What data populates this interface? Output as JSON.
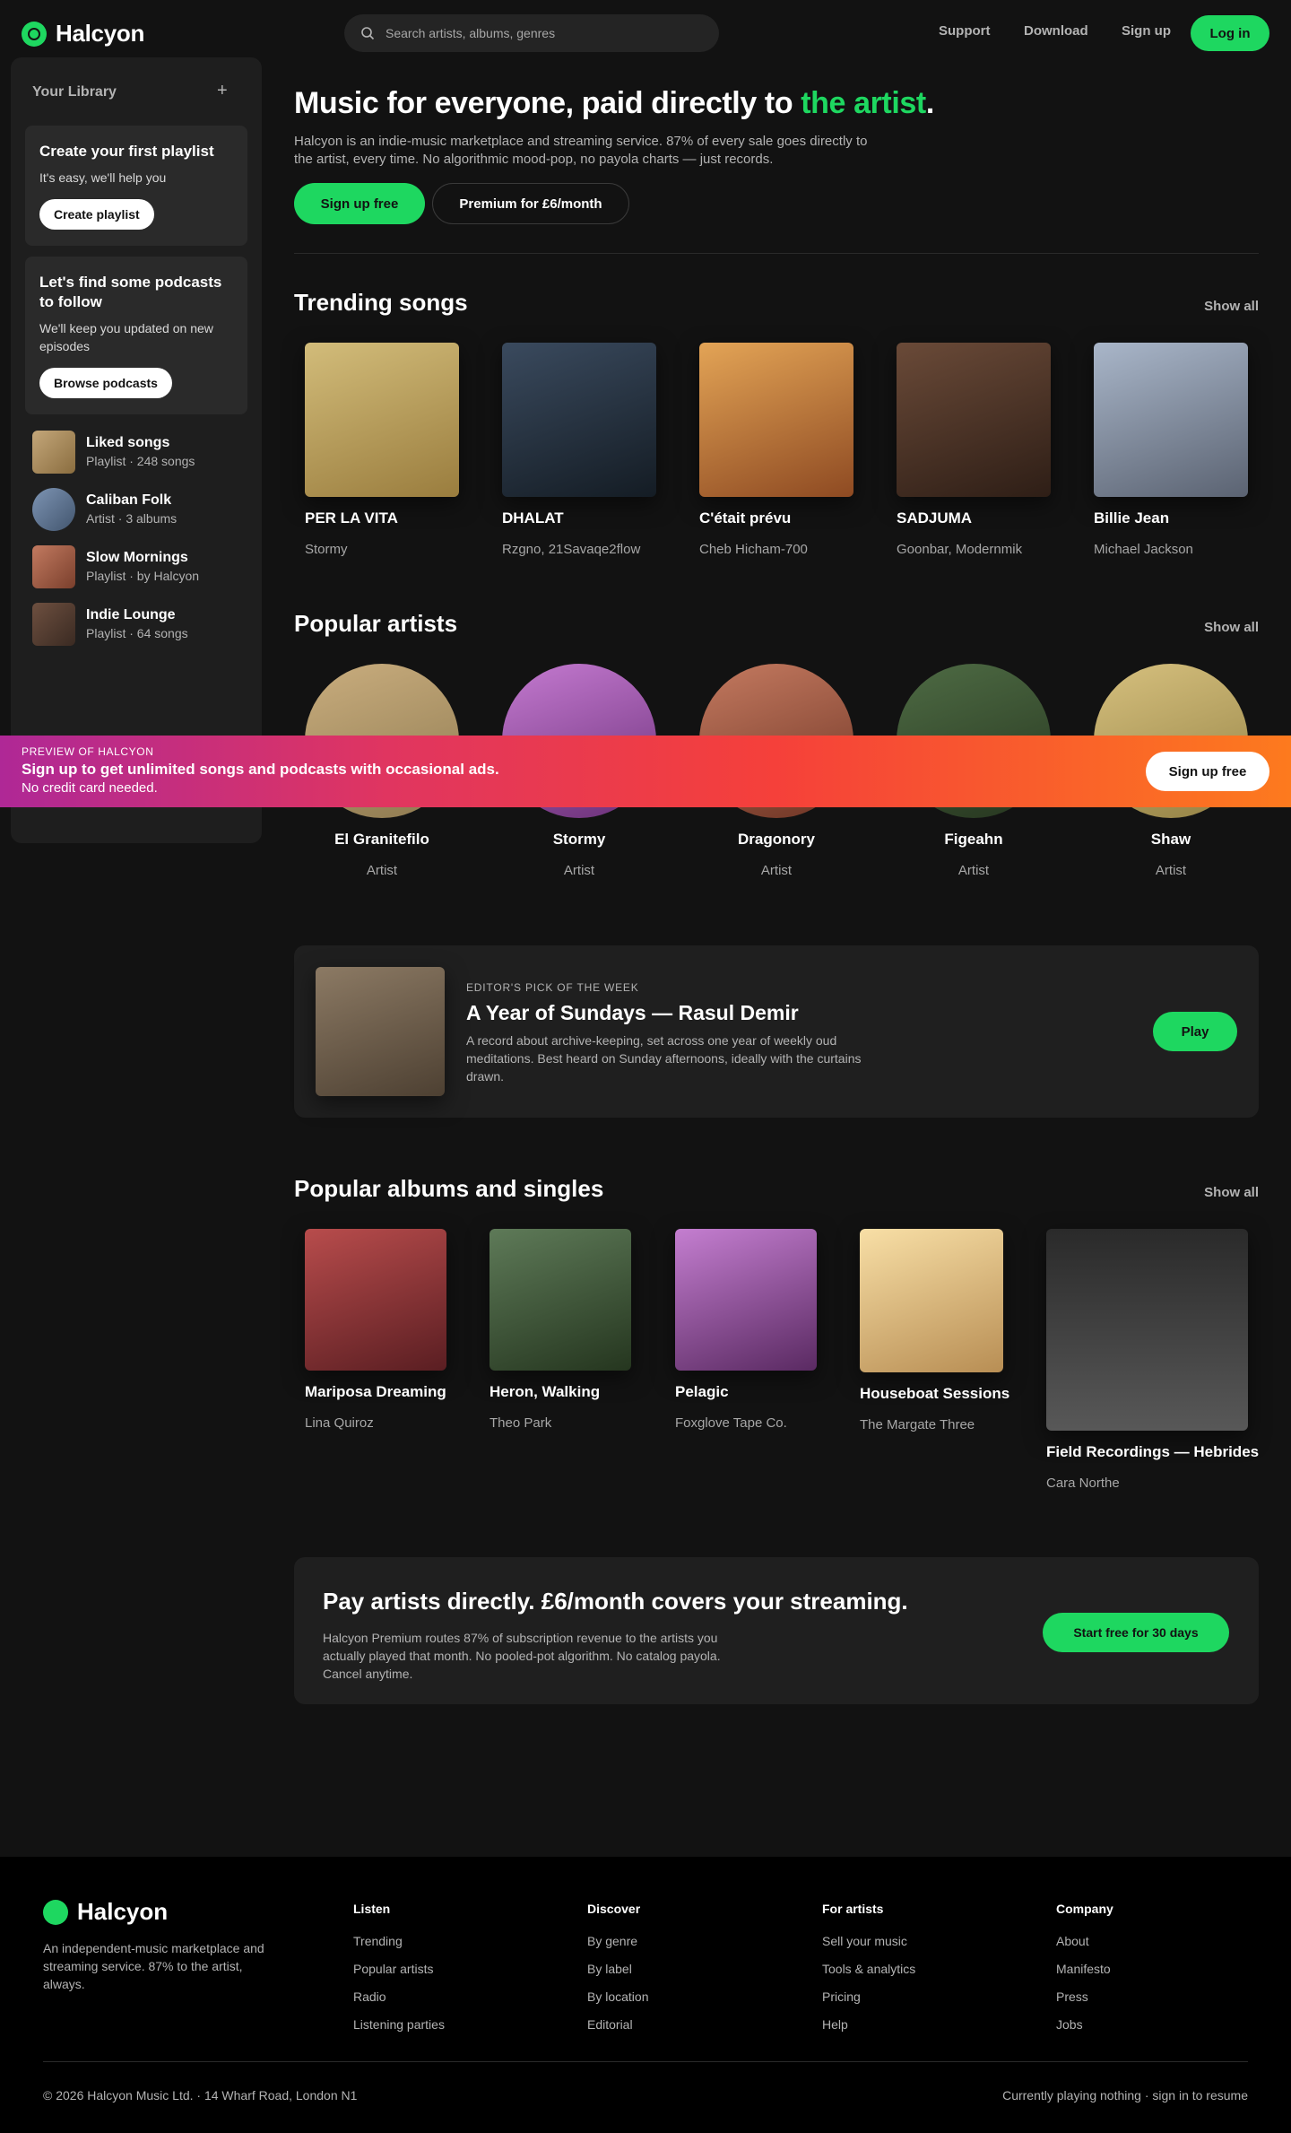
{
  "brand": {
    "name": "Halcyon",
    "accent": "#1ed760"
  },
  "search": {
    "placeholder": "Search artists, albums, genres",
    "icon": "search-icon"
  },
  "nav": {
    "support": "Support",
    "download": "Download",
    "signup": "Sign up",
    "login": "Log in"
  },
  "sidebar": {
    "title": "Your Library",
    "add_icon": "+",
    "playlist_card": {
      "title": "Create your first playlist",
      "text": "It's easy, we'll help you",
      "button": "Create playlist"
    },
    "podcast_card": {
      "title": "Let's find some podcasts to follow",
      "text": "We'll keep you updated on new episodes",
      "button": "Browse podcasts"
    },
    "items": [
      {
        "title": "Liked songs",
        "sub": "Playlist · 248 songs"
      },
      {
        "title": "Caliban Folk",
        "sub": "Artist · 3 albums"
      },
      {
        "title": "Slow Mornings",
        "sub": "Playlist · by Halcyon"
      },
      {
        "title": "Indie Lounge",
        "sub": "Playlist · 64 songs"
      }
    ]
  },
  "hero": {
    "title_prefix": "Music for everyone, paid directly to ",
    "title_accent": "the artist",
    "title_suffix": ".",
    "subtitle": "Halcyon is an indie-music marketplace and streaming service. 87% of every sale goes directly to the artist, every time. No algorithmic mood-pop, no payola charts — just records.",
    "primary_button": "Sign up free",
    "secondary_button": "Premium for £6/month"
  },
  "trending": {
    "title": "Trending songs",
    "show_all": "Show all",
    "items": [
      {
        "title": "PER LA VITA",
        "sub": "Stormy"
      },
      {
        "title": "DHALAT",
        "sub": "Rzgno, 21Savaqe2flow"
      },
      {
        "title": "C'était prévu",
        "sub": "Cheb Hicham-700"
      },
      {
        "title": "SADJUMA",
        "sub": "Goonbar, Modernmik"
      },
      {
        "title": "Billie Jean",
        "sub": "Michael Jackson"
      }
    ]
  },
  "artists": {
    "title": "Popular artists",
    "show_all": "Show all",
    "items": [
      {
        "name": "El Granitefilo",
        "role": "Artist"
      },
      {
        "name": "Stormy",
        "role": "Artist"
      },
      {
        "name": "Dragonory",
        "role": "Artist"
      },
      {
        "name": "Figeahn",
        "role": "Artist"
      },
      {
        "name": "Shaw",
        "role": "Artist"
      }
    ]
  },
  "banner": {
    "eyebrow": "PREVIEW OF HALCYON",
    "title": "Sign up to get unlimited songs and podcasts with occasional ads.",
    "sub": "No credit card needed.",
    "button": "Sign up free"
  },
  "editors_pick": {
    "eyebrow": "EDITOR'S PICK OF THE WEEK",
    "title": "A Year of Sundays — Rasul Demir",
    "text": "A record about archive-keeping, set across one year of weekly oud meditations. Best heard on Sunday afternoons, ideally with the curtains drawn.",
    "button": "Play"
  },
  "albums": {
    "title": "Popular albums and singles",
    "show_all": "Show all",
    "items": [
      {
        "title": "Mariposa Dreaming",
        "sub": "Lina Quiroz"
      },
      {
        "title": "Heron, Walking",
        "sub": "Theo Park"
      },
      {
        "title": "Pelagic",
        "sub": "Foxglove Tape Co."
      },
      {
        "title": "Houseboat Sessions",
        "sub": "The Margate Three"
      },
      {
        "title": "Field Recordings — Hebrides",
        "sub": "Cara Northe"
      }
    ]
  },
  "pay": {
    "title": "Pay artists directly. £6/month covers your streaming.",
    "text": "Halcyon Premium routes 87% of subscription revenue to the artists you actually played that month. No pooled-pot algorithm. No catalog payola. Cancel anytime.",
    "button": "Start free for 30 days"
  },
  "footer": {
    "brand": "Halcyon",
    "description": "An independent-music marketplace and streaming service. 87% to the artist, always.",
    "columns": [
      {
        "heading": "Listen",
        "links": [
          "Trending",
          "Popular artists",
          "Radio",
          "Listening parties"
        ]
      },
      {
        "heading": "Discover",
        "links": [
          "By genre",
          "By label",
          "By location",
          "Editorial"
        ]
      },
      {
        "heading": "For artists",
        "links": [
          "Sell your music",
          "Tools & analytics",
          "Pricing",
          "Help"
        ]
      },
      {
        "heading": "Company",
        "links": [
          "About",
          "Manifesto",
          "Press",
          "Jobs"
        ]
      }
    ],
    "copyright": "© 2026 Halcyon Music Ltd. · 14 Wharf Road, London N1",
    "now_playing": "Currently playing nothing · sign in to resume"
  }
}
